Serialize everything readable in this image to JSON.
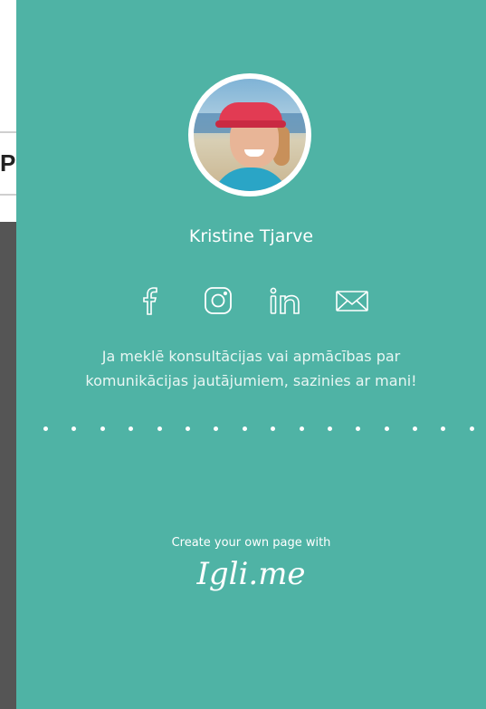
{
  "background": {
    "partial_letter": "P"
  },
  "profile": {
    "name": "Kristine Tjarve",
    "bio_line1": "Ja meklē konsultācijas vai apmācības par",
    "bio_line2": "komunikācijas jautājumiem, sazinies ar mani!"
  },
  "socials": [
    {
      "icon": "facebook-icon"
    },
    {
      "icon": "instagram-icon"
    },
    {
      "icon": "linkedin-icon"
    },
    {
      "icon": "email-icon"
    }
  ],
  "footer": {
    "cta": "Create your own page with",
    "brand": "Igli.me"
  },
  "colors": {
    "card_bg": "#4fb3a5",
    "text": "#ffffff"
  }
}
